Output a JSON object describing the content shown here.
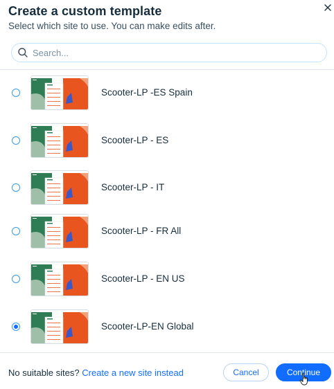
{
  "dialog": {
    "title": "Create a custom template",
    "subtitle": "Select which site to use. You can make edits after."
  },
  "search": {
    "placeholder": "Search...",
    "value": ""
  },
  "sites": [
    {
      "label": "Scooter-LP -ES Spain",
      "selected": false
    },
    {
      "label": "Scooter-LP - ES",
      "selected": false
    },
    {
      "label": "Scooter-LP - IT",
      "selected": false
    },
    {
      "label": "Scooter-LP - FR All",
      "selected": false
    },
    {
      "label": "Scooter-LP - EN US",
      "selected": false
    },
    {
      "label": "Scooter-LP-EN Global",
      "selected": true
    }
  ],
  "footer": {
    "prompt": "No suitable sites?",
    "link": "Create a new site instead",
    "cancel_label": "Cancel",
    "continue_label": "Continue"
  },
  "colors": {
    "accent": "#116dff",
    "thumb_green": "#2f7d55",
    "thumb_orange": "#e8551f",
    "thumb_sage": "#9fbfa8"
  },
  "icons": {
    "close": "close-icon",
    "search": "search-icon",
    "cursor": "hand-pointer-icon"
  }
}
